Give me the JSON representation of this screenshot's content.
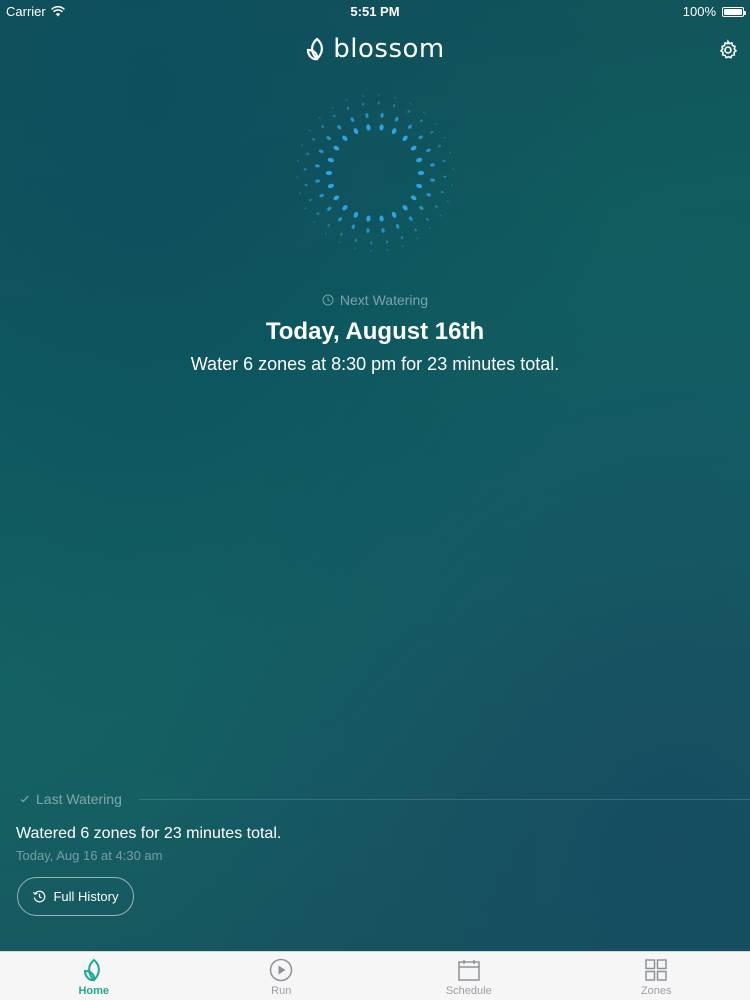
{
  "status_bar": {
    "carrier": "Carrier",
    "time": "5:51 PM",
    "battery": "100%"
  },
  "header": {
    "logo_text": "blossom",
    "icons": {
      "logo": "leaf-logo-icon",
      "settings": "gear-icon"
    }
  },
  "next_watering": {
    "label": "Next Watering",
    "date": "Today, August 16th",
    "description": "Water 6 zones at 8:30 pm for 23 minutes total."
  },
  "last_watering": {
    "label": "Last Watering",
    "summary": "Watered 6 zones for 23 minutes total.",
    "time": "Today, Aug 16 at 4:30 am",
    "history_button": "Full History"
  },
  "tabs": [
    {
      "label": "Home",
      "icon": "leaf-icon",
      "active": true
    },
    {
      "label": "Run",
      "icon": "play-icon",
      "active": false
    },
    {
      "label": "Schedule",
      "icon": "calendar-icon",
      "active": false
    },
    {
      "label": "Zones",
      "icon": "grid-icon",
      "active": false
    }
  ],
  "colors": {
    "accent": "#1ea98c",
    "drop_blue": "#2ea8f0",
    "tab_inactive": "#9a9ea3"
  }
}
